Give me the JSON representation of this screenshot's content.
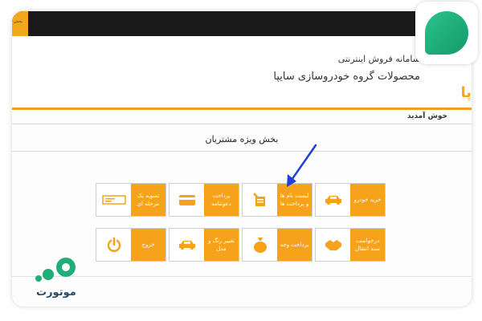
{
  "topbar": {
    "tab_label": "بخش"
  },
  "header": {
    "line1": "سامانه فروش اینترنتی",
    "line2": "محصولات گروه خودروسازی سایپا",
    "logo": "پا"
  },
  "welcome": "خوش آمدید",
  "section_title": "بخش ویژه مشتریان",
  "tiles": {
    "buy_car": "خرید خودرو",
    "list_names": "لیست نام ها و پرداخت ها",
    "online_payment": "پرداخت دعوتنامه",
    "settlement": "تسویه یک مرحله ای",
    "request_reg": "درخواست سند انتقال",
    "receive_payment": "پرداخت وجه",
    "change_color": "تغییر رنگ و مدل",
    "exit": "خروج"
  },
  "brand_label": "موتورت",
  "colors": {
    "accent": "#f7a21b",
    "badge": "#1fae7a",
    "arrow": "#1f3fd6"
  },
  "icons": [
    "car-icon",
    "document-pen-icon",
    "card-icon",
    "check-icon",
    "handshake-icon",
    "money-bag-icon",
    "car-icon",
    "power-icon"
  ]
}
